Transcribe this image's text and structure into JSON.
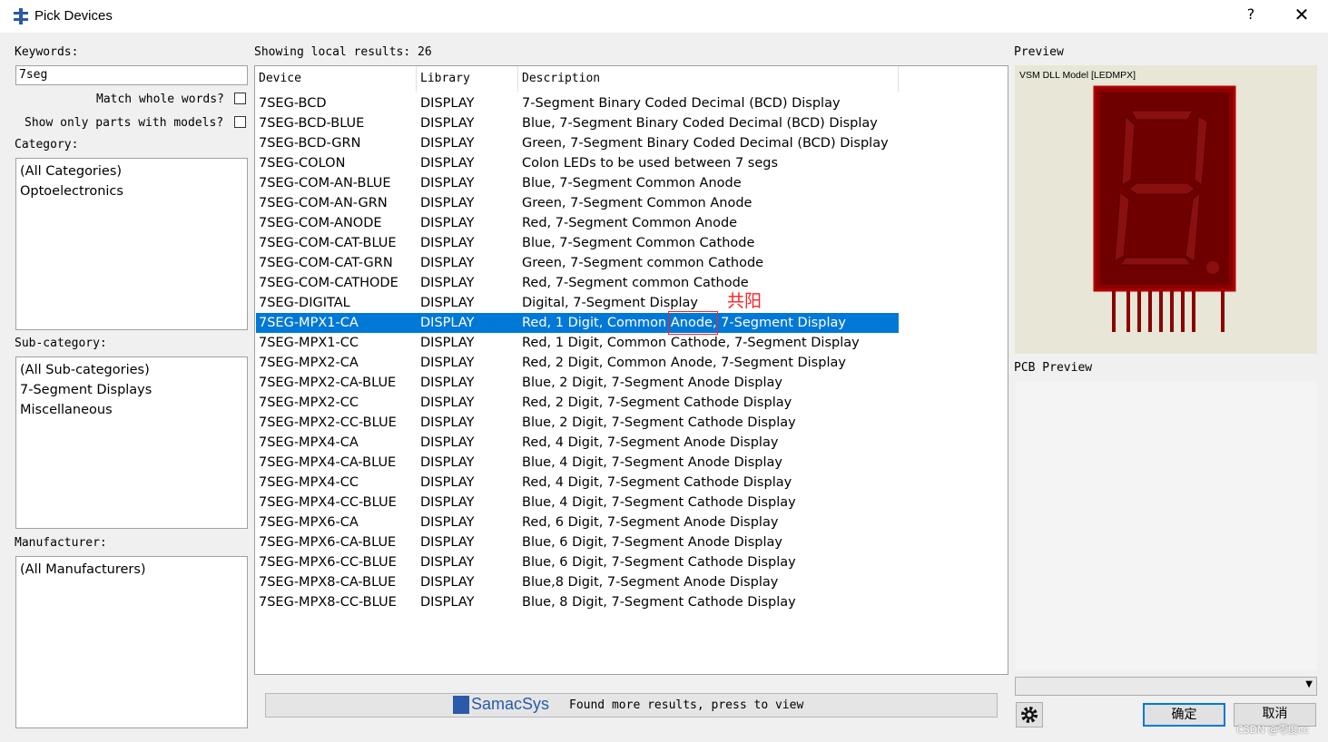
{
  "window": {
    "title": "Pick Devices",
    "help_label": "?",
    "close_label": "✕"
  },
  "left": {
    "keywords_label": "Keywords:",
    "keywords_value": "7seg",
    "match_whole_words_label": "Match whole words?",
    "show_only_models_label": "Show only parts with models?",
    "category_label": "Category:",
    "categories": [
      "(All Categories)",
      "Optoelectronics"
    ],
    "subcategory_label": "Sub-category:",
    "subcategories": [
      "(All Sub-categories)",
      "7-Segment Displays",
      "Miscellaneous"
    ],
    "manufacturer_label": "Manufacturer:",
    "manufacturers": [
      "(All Manufacturers)"
    ]
  },
  "results": {
    "summary": "Showing local results: 26",
    "columns": [
      "Device",
      "Library",
      "Description"
    ],
    "selected_index": 11,
    "rows": [
      [
        "7SEG-BCD",
        "DISPLAY",
        "7-Segment Binary Coded Decimal (BCD) Display"
      ],
      [
        "7SEG-BCD-BLUE",
        "DISPLAY",
        "Blue,  7-Segment Binary Coded Decimal (BCD) Display"
      ],
      [
        "7SEG-BCD-GRN",
        "DISPLAY",
        "Green, 7-Segment Binary Coded Decimal (BCD) Display"
      ],
      [
        "7SEG-COLON",
        "DISPLAY",
        "Colon LEDs to be used between 7 segs"
      ],
      [
        "7SEG-COM-AN-BLUE",
        "DISPLAY",
        "Blue, 7-Segment Common Anode"
      ],
      [
        "7SEG-COM-AN-GRN",
        "DISPLAY",
        "Green, 7-Segment Common Anode"
      ],
      [
        "7SEG-COM-ANODE",
        "DISPLAY",
        "Red, 7-Segment Common Anode"
      ],
      [
        "7SEG-COM-CAT-BLUE",
        "DISPLAY",
        "Blue, 7-Segment Common Cathode"
      ],
      [
        "7SEG-COM-CAT-GRN",
        "DISPLAY",
        "Green, 7-Segment common Cathode"
      ],
      [
        "7SEG-COM-CATHODE",
        "DISPLAY",
        "Red, 7-Segment common Cathode"
      ],
      [
        "7SEG-DIGITAL",
        "DISPLAY",
        "Digital, 7-Segment Display"
      ],
      [
        "7SEG-MPX1-CA",
        "DISPLAY",
        "Red, 1 Digit, Common Anode, 7-Segment Display"
      ],
      [
        "7SEG-MPX1-CC",
        "DISPLAY",
        "Red, 1 Digit, Common Cathode, 7-Segment Display"
      ],
      [
        "7SEG-MPX2-CA",
        "DISPLAY",
        "Red, 2 Digit, Common Anode, 7-Segment Display"
      ],
      [
        "7SEG-MPX2-CA-BLUE",
        "DISPLAY",
        "Blue, 2 Digit, 7-Segment Anode Display"
      ],
      [
        "7SEG-MPX2-CC",
        "DISPLAY",
        "Red, 2 Digit, 7-Segment Cathode Display"
      ],
      [
        "7SEG-MPX2-CC-BLUE",
        "DISPLAY",
        "Blue, 2 Digit, 7-Segment Cathode Display"
      ],
      [
        "7SEG-MPX4-CA",
        "DISPLAY",
        "Red, 4 Digit, 7-Segment Anode Display"
      ],
      [
        "7SEG-MPX4-CA-BLUE",
        "DISPLAY",
        "Blue, 4 Digit, 7-Segment Anode Display"
      ],
      [
        "7SEG-MPX4-CC",
        "DISPLAY",
        "Red, 4 Digit, 7-Segment Cathode Display"
      ],
      [
        "7SEG-MPX4-CC-BLUE",
        "DISPLAY",
        "Blue, 4 Digit, 7-Segment Cathode Display"
      ],
      [
        "7SEG-MPX6-CA",
        "DISPLAY",
        "Red, 6 Digit, 7-Segment Anode Display"
      ],
      [
        "7SEG-MPX6-CA-BLUE",
        "DISPLAY",
        "Blue, 6 Digit, 7-Segment Anode Display"
      ],
      [
        "7SEG-MPX6-CC-BLUE",
        "DISPLAY",
        "Blue, 6 Digit, 7-Segment Cathode Display"
      ],
      [
        "7SEG-MPX8-CA-BLUE",
        "DISPLAY",
        "Blue,8 Digit, 7-Segment Anode Display"
      ],
      [
        "7SEG-MPX8-CC-BLUE",
        "DISPLAY",
        "Blue, 8 Digit, 7-Segment Cathode Display"
      ]
    ],
    "annotation": "共阳"
  },
  "bottom": {
    "samacsys_label": "SamacSys",
    "found_more": "Found more results, press to view"
  },
  "right": {
    "preview_label": "Preview",
    "model_label": "VSM DLL Model [LEDMPX]",
    "pcb_preview_label": "PCB Preview",
    "ok_label": "确定",
    "cancel_label": "取消",
    "watermark": "CSDN @零度cc"
  },
  "colors": {
    "selection": "#0078d7",
    "segment_dark": "#8b0000",
    "annotation_red": "#ff2020"
  }
}
